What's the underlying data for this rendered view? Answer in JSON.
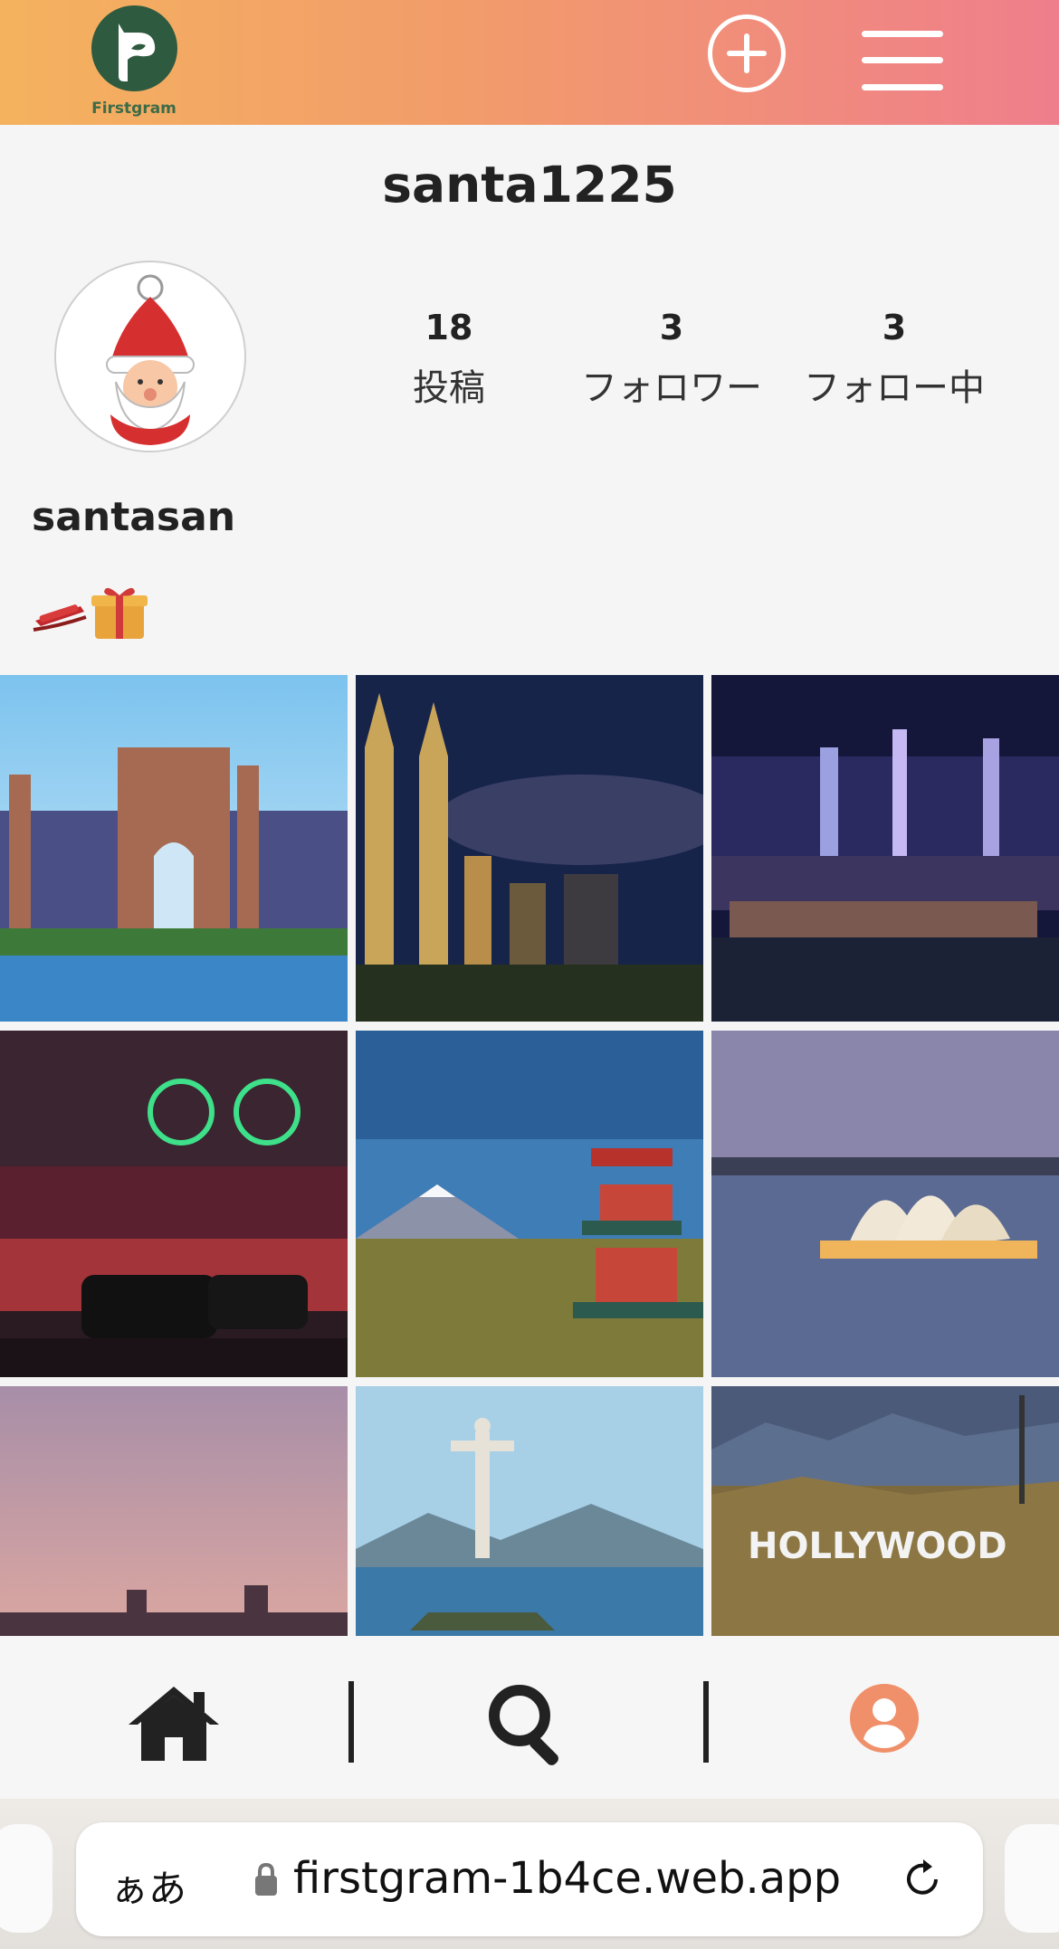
{
  "app": {
    "logo_text": "Firstgram"
  },
  "colors": {
    "header_start": "#f4b25e",
    "header_end": "#ef7e8c",
    "active_nav": "#f0906a"
  },
  "profile": {
    "username": "santa1225",
    "display_name": "santasan",
    "bio_icons": [
      "sled-emoji",
      "gift-emoji"
    ],
    "stats": [
      {
        "value": "18",
        "label": "投稿"
      },
      {
        "value": "3",
        "label": "フォロワー"
      },
      {
        "value": "3",
        "label": "フォロー中"
      }
    ]
  },
  "posts": [
    {
      "icon": "atlantis-palace-photo"
    },
    {
      "icon": "petronas-towers-photo"
    },
    {
      "icon": "hong-kong-night-photo"
    },
    {
      "icon": "neon-street-photo"
    },
    {
      "icon": "mount-fuji-pagoda-photo"
    },
    {
      "icon": "sydney-opera-house-photo"
    },
    {
      "icon": "moai-sunset-photo"
    },
    {
      "icon": "christ-redeemer-photo"
    },
    {
      "icon": "hollywood-sign-photo",
      "sign_text": "HOLLYWOOD"
    }
  ],
  "nav": {
    "items": [
      "home-icon",
      "search-icon",
      "profile-icon"
    ],
    "active": "profile-icon"
  },
  "browser": {
    "aa_label": "ぁあ",
    "url": "firstgram-1b4ce.web.app"
  }
}
